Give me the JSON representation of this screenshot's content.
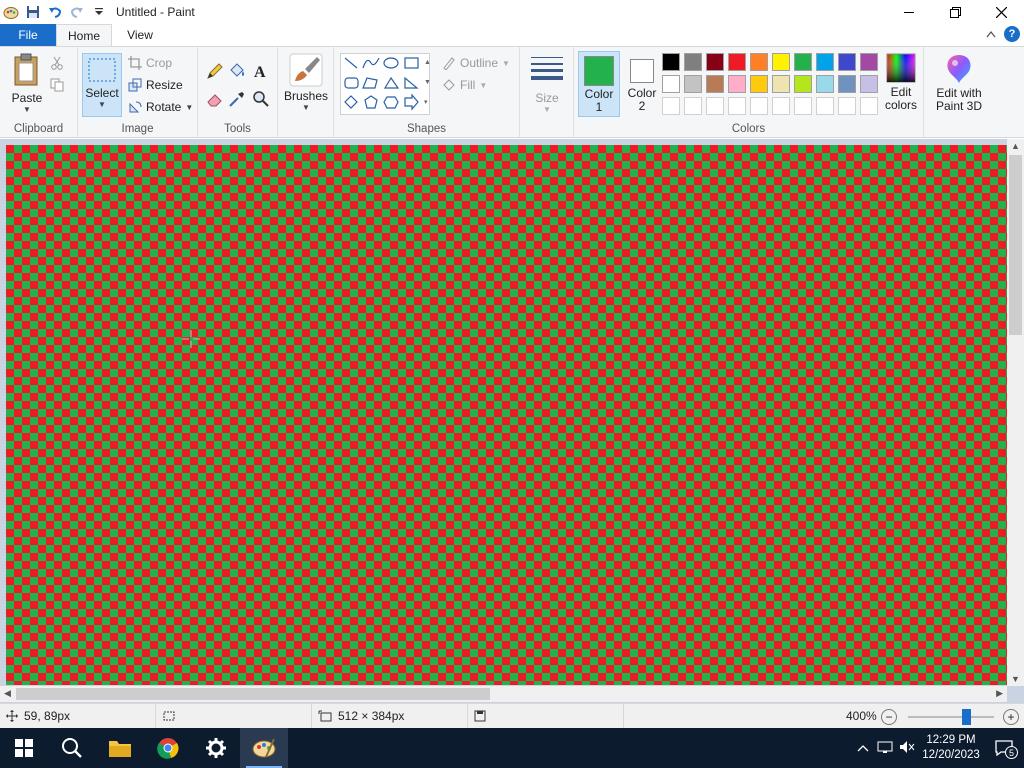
{
  "window": {
    "title": "Untitled - Paint"
  },
  "tabs": {
    "file": "File",
    "home": "Home",
    "view": "View"
  },
  "clipboard": {
    "paste": "Paste",
    "label": "Clipboard"
  },
  "image": {
    "select": "Select",
    "crop": "Crop",
    "resize": "Resize",
    "rotate": "Rotate",
    "label": "Image"
  },
  "tools": {
    "label": "Tools"
  },
  "brushes": {
    "label": "Brushes"
  },
  "shapes": {
    "outline": "Outline",
    "fill": "Fill",
    "label": "Shapes"
  },
  "size": {
    "label": "Size"
  },
  "colors": {
    "color1": "Color\n1",
    "color1_value": "#22b14c",
    "color2": "Color\n2",
    "color2_value": "#ffffff",
    "label": "Colors",
    "edit": "Edit\ncolors",
    "palette_row1": [
      "#000000",
      "#7f7f7f",
      "#880015",
      "#ed1c24",
      "#ff7f27",
      "#fff200",
      "#22b14c",
      "#00a2e8",
      "#3f48cc",
      "#a349a4"
    ],
    "palette_row2": [
      "#ffffff",
      "#c3c3c3",
      "#b97a57",
      "#ffaec9",
      "#ffc90e",
      "#efe4b0",
      "#b5e61d",
      "#99d9ea",
      "#7092be",
      "#c8bfe7"
    ]
  },
  "paint3d": {
    "label": "Edit with\nPaint 3D"
  },
  "canvas": {
    "color_a": "#ed1c24",
    "color_b": "#22b14c"
  },
  "status": {
    "cursor_pos": "59, 89px",
    "image_size": "512 × 384px",
    "zoom": "400%",
    "zoom_slider": 0.67
  },
  "taskbar": {
    "time": "12:29 PM",
    "date": "12/20/2023",
    "notifications": "5"
  }
}
